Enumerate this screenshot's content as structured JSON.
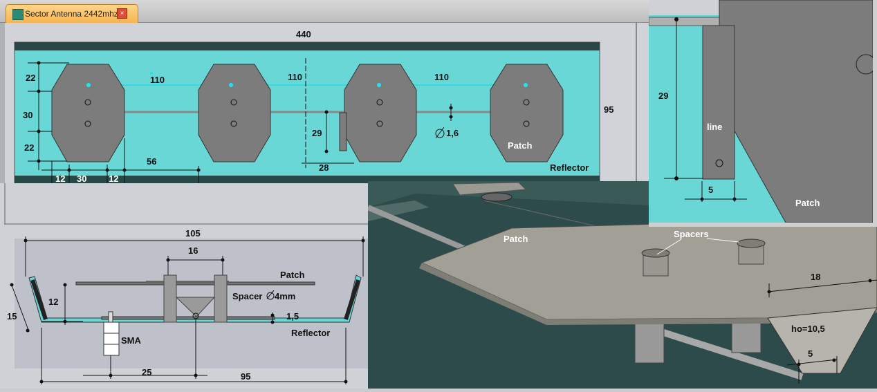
{
  "tab": {
    "title": "Sector Antenna 2442mhz*",
    "close": "×"
  },
  "top_view": {
    "overall_width": "440",
    "height": "95",
    "pitch_1": "110",
    "pitch_2": "110",
    "pitch_3": "110",
    "top_margin": "22",
    "patch_height": "30",
    "bottom_margin": "22",
    "offset": "56",
    "edge_left": "12",
    "patch_width": "30",
    "edge_right": "12",
    "feed_height": "29",
    "feed_width": "28",
    "diameter": "1,6",
    "patch_label": "Patch",
    "reflector_label": "Reflector"
  },
  "side_view": {
    "top_width": "105",
    "spacing": "16",
    "height": "12",
    "slant": "15",
    "thickness": "1,5",
    "sma_offset": "25",
    "bottom_width": "95",
    "patch_label": "Patch",
    "spacer_label": "Spacer",
    "spacer_dim": "4mm",
    "reflector_label": "Reflector",
    "sma_label": "SMA"
  },
  "detail_view": {
    "height": "29",
    "width": "5",
    "line_label": "line",
    "patch_label": "Patch"
  },
  "render_view": {
    "patch_label": "Patch",
    "spacers_label": "Spacers",
    "dim_18": "18",
    "ho_label": "ho=10,5",
    "dim_5": "5"
  }
}
